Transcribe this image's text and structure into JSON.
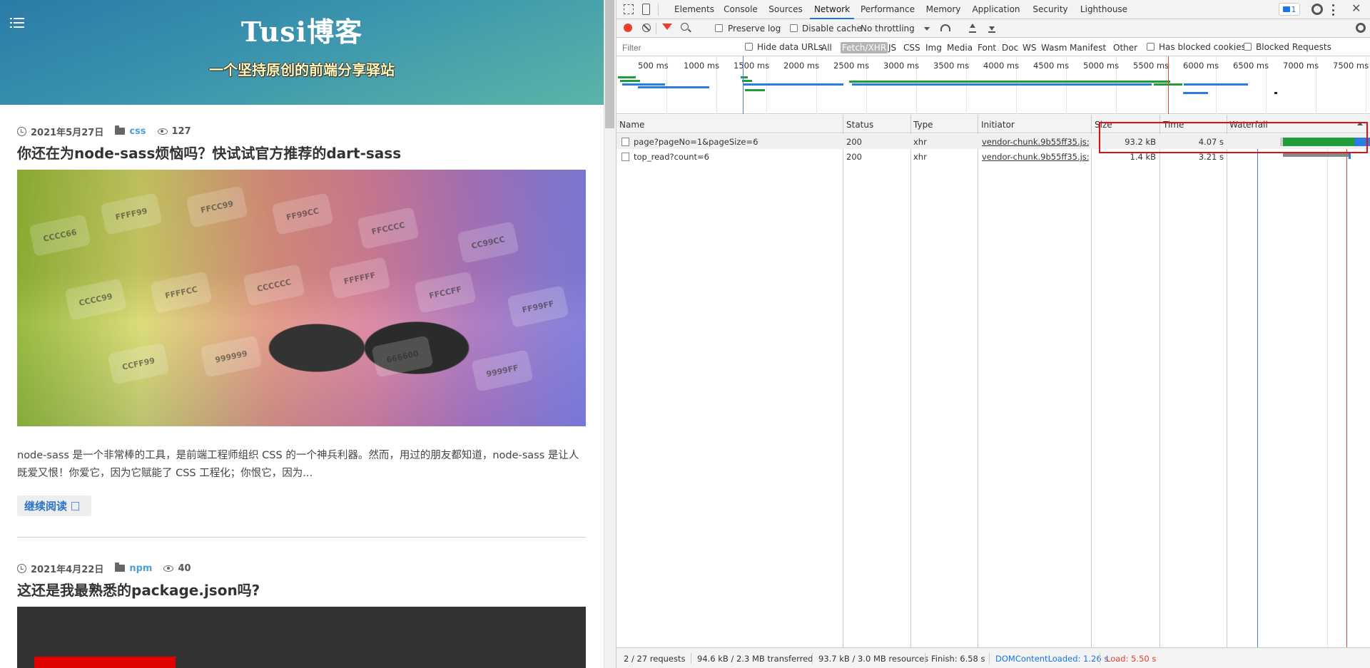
{
  "blog": {
    "title": "Tusi博客",
    "subtitle": "一个坚持原创的前端分享驿站",
    "posts": [
      {
        "date": "2021年5月27日",
        "category": "css",
        "views": "127",
        "title": "你还在为node-sass烦恼吗？快试试官方推荐的dart-sass",
        "excerpt": "node-sass 是一个非常棒的工具，是前端工程师组织 CSS 的一个神兵利器。然而，用过的朋友都知道，node-sass 是让人既爱又恨！你爱它，因为它赋能了 CSS 工程化；你恨它，因为...",
        "read_more": "继续阅读",
        "image_swatches": [
          "CCCC66",
          "FFFF99",
          "FFCC99",
          "FF99CC",
          "FFCCCC",
          "CC99CC",
          "CCCC99",
          "FFFFCC",
          "CCCCCC",
          "FFFFFF",
          "FFCCFF",
          "FF99FF",
          "CCFF99",
          "999999",
          "666600",
          "9999FF"
        ]
      },
      {
        "date": "2021年4月22日",
        "category": "npm",
        "views": "40",
        "title": "这还是我最熟悉的package.json吗?"
      }
    ]
  },
  "devtools": {
    "tabs": [
      "Elements",
      "Console",
      "Sources",
      "Network",
      "Performance",
      "Memory",
      "Application",
      "Security",
      "Lighthouse"
    ],
    "active_tab": "Network",
    "badge_count": "1",
    "toolbar": {
      "preserve_log": "Preserve log",
      "disable_cache": "Disable cache",
      "throttling": "No throttling"
    },
    "filterbar": {
      "filter_placeholder": "Filter",
      "hide_data_urls": "Hide data URLs",
      "types": [
        "All",
        "Fetch/XHR",
        "JS",
        "CSS",
        "Img",
        "Media",
        "Font",
        "Doc",
        "WS",
        "Wasm",
        "Manifest",
        "Other"
      ],
      "active_type": "Fetch/XHR",
      "has_blocked_cookies": "Has blocked cookies",
      "blocked_requests": "Blocked Requests"
    },
    "overview_ticks": [
      "500 ms",
      "1000 ms",
      "1500 ms",
      "2000 ms",
      "2500 ms",
      "3000 ms",
      "3500 ms",
      "4000 ms",
      "4500 ms",
      "5000 ms",
      "5500 ms",
      "6000 ms",
      "6500 ms",
      "7000 ms",
      "7500 ms"
    ],
    "columns": [
      "Name",
      "Status",
      "Type",
      "Initiator",
      "Size",
      "Time",
      "Waterfall"
    ],
    "requests": [
      {
        "name": "page?pageNo=1&pageSize=6",
        "status": "200",
        "type": "xhr",
        "initiator": "vendor-chunk.9b55ff35.js:...",
        "size": "93.2 kB",
        "time": "4.07 s"
      },
      {
        "name": "top_read?count=6",
        "status": "200",
        "type": "xhr",
        "initiator": "vendor-chunk.9b55ff35.js:...",
        "size": "1.4 kB",
        "time": "3.21 s"
      }
    ],
    "status": {
      "requests": "2 / 27 requests",
      "transferred": "94.6 kB / 2.3 MB transferred",
      "resources": "93.7 kB / 3.0 MB resources",
      "finish": "Finish: 6.58 s",
      "domcontentloaded": "DOMContentLoaded: 1.26 s",
      "load": "Load: 5.50 s"
    },
    "colors": {
      "accent": "#1a73e8",
      "record": "#e8402f",
      "dcl": "#1a73e8",
      "load": "#e8402f",
      "highlight": "#e01010"
    }
  }
}
